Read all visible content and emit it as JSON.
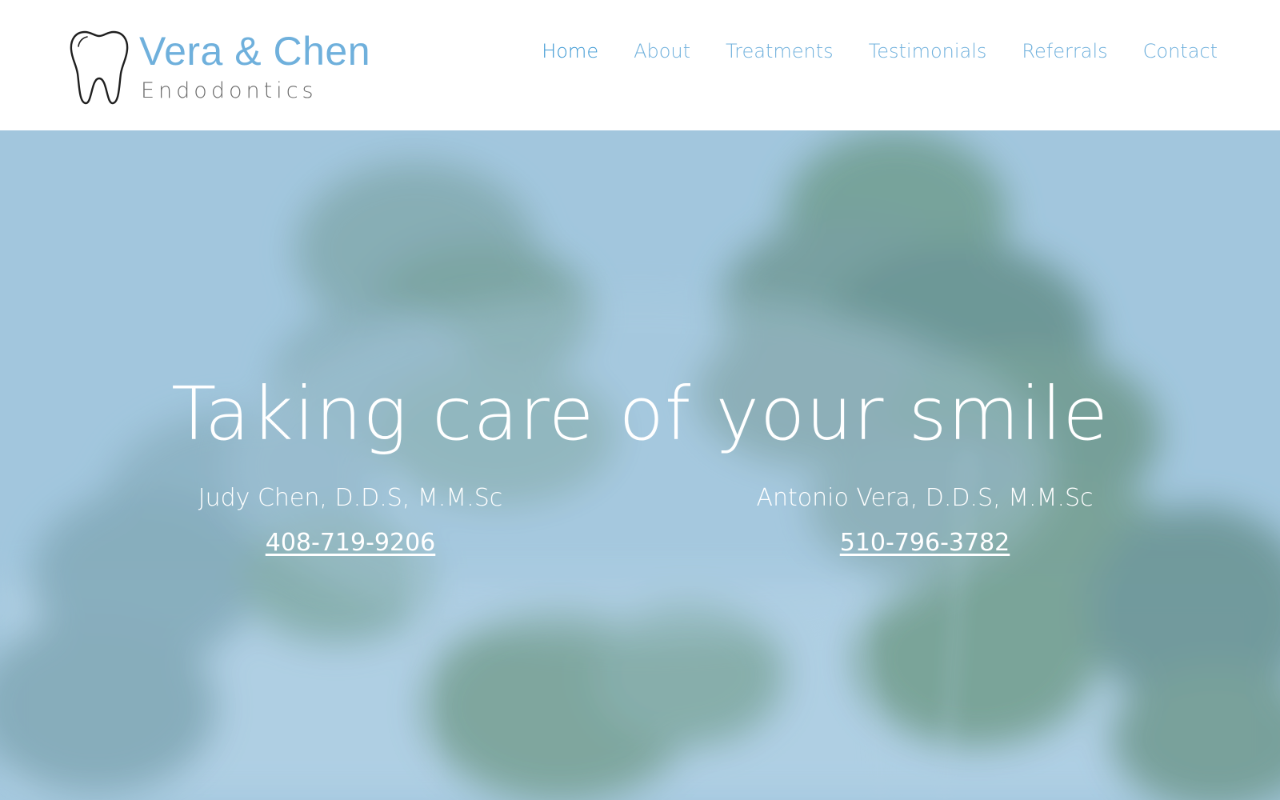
{
  "brand": {
    "name": "Vera & Chen",
    "subtitle": "Endodontics",
    "logo_icon": "tooth-icon"
  },
  "nav": {
    "items": [
      {
        "label": "Home",
        "active": true
      },
      {
        "label": "About",
        "active": false
      },
      {
        "label": "Treatments",
        "active": false
      },
      {
        "label": "Testimonials",
        "active": false
      },
      {
        "label": "Referrals",
        "active": false
      },
      {
        "label": "Contact",
        "active": false
      }
    ]
  },
  "hero": {
    "title": "Taking care of your smile",
    "doctors": [
      {
        "name": "Judy Chen, D.D.S, M.M.Sc",
        "phone": "408-719-9206"
      },
      {
        "name": "Antonio Vera, D.D.S, M.M.Sc",
        "phone": "510-796-3782"
      }
    ]
  },
  "colors": {
    "brand_blue": "#6fb0dc",
    "nav_active": "#3f9ad4",
    "hero_sky": "#a7cbe1",
    "foliage": "#6f9a84"
  }
}
